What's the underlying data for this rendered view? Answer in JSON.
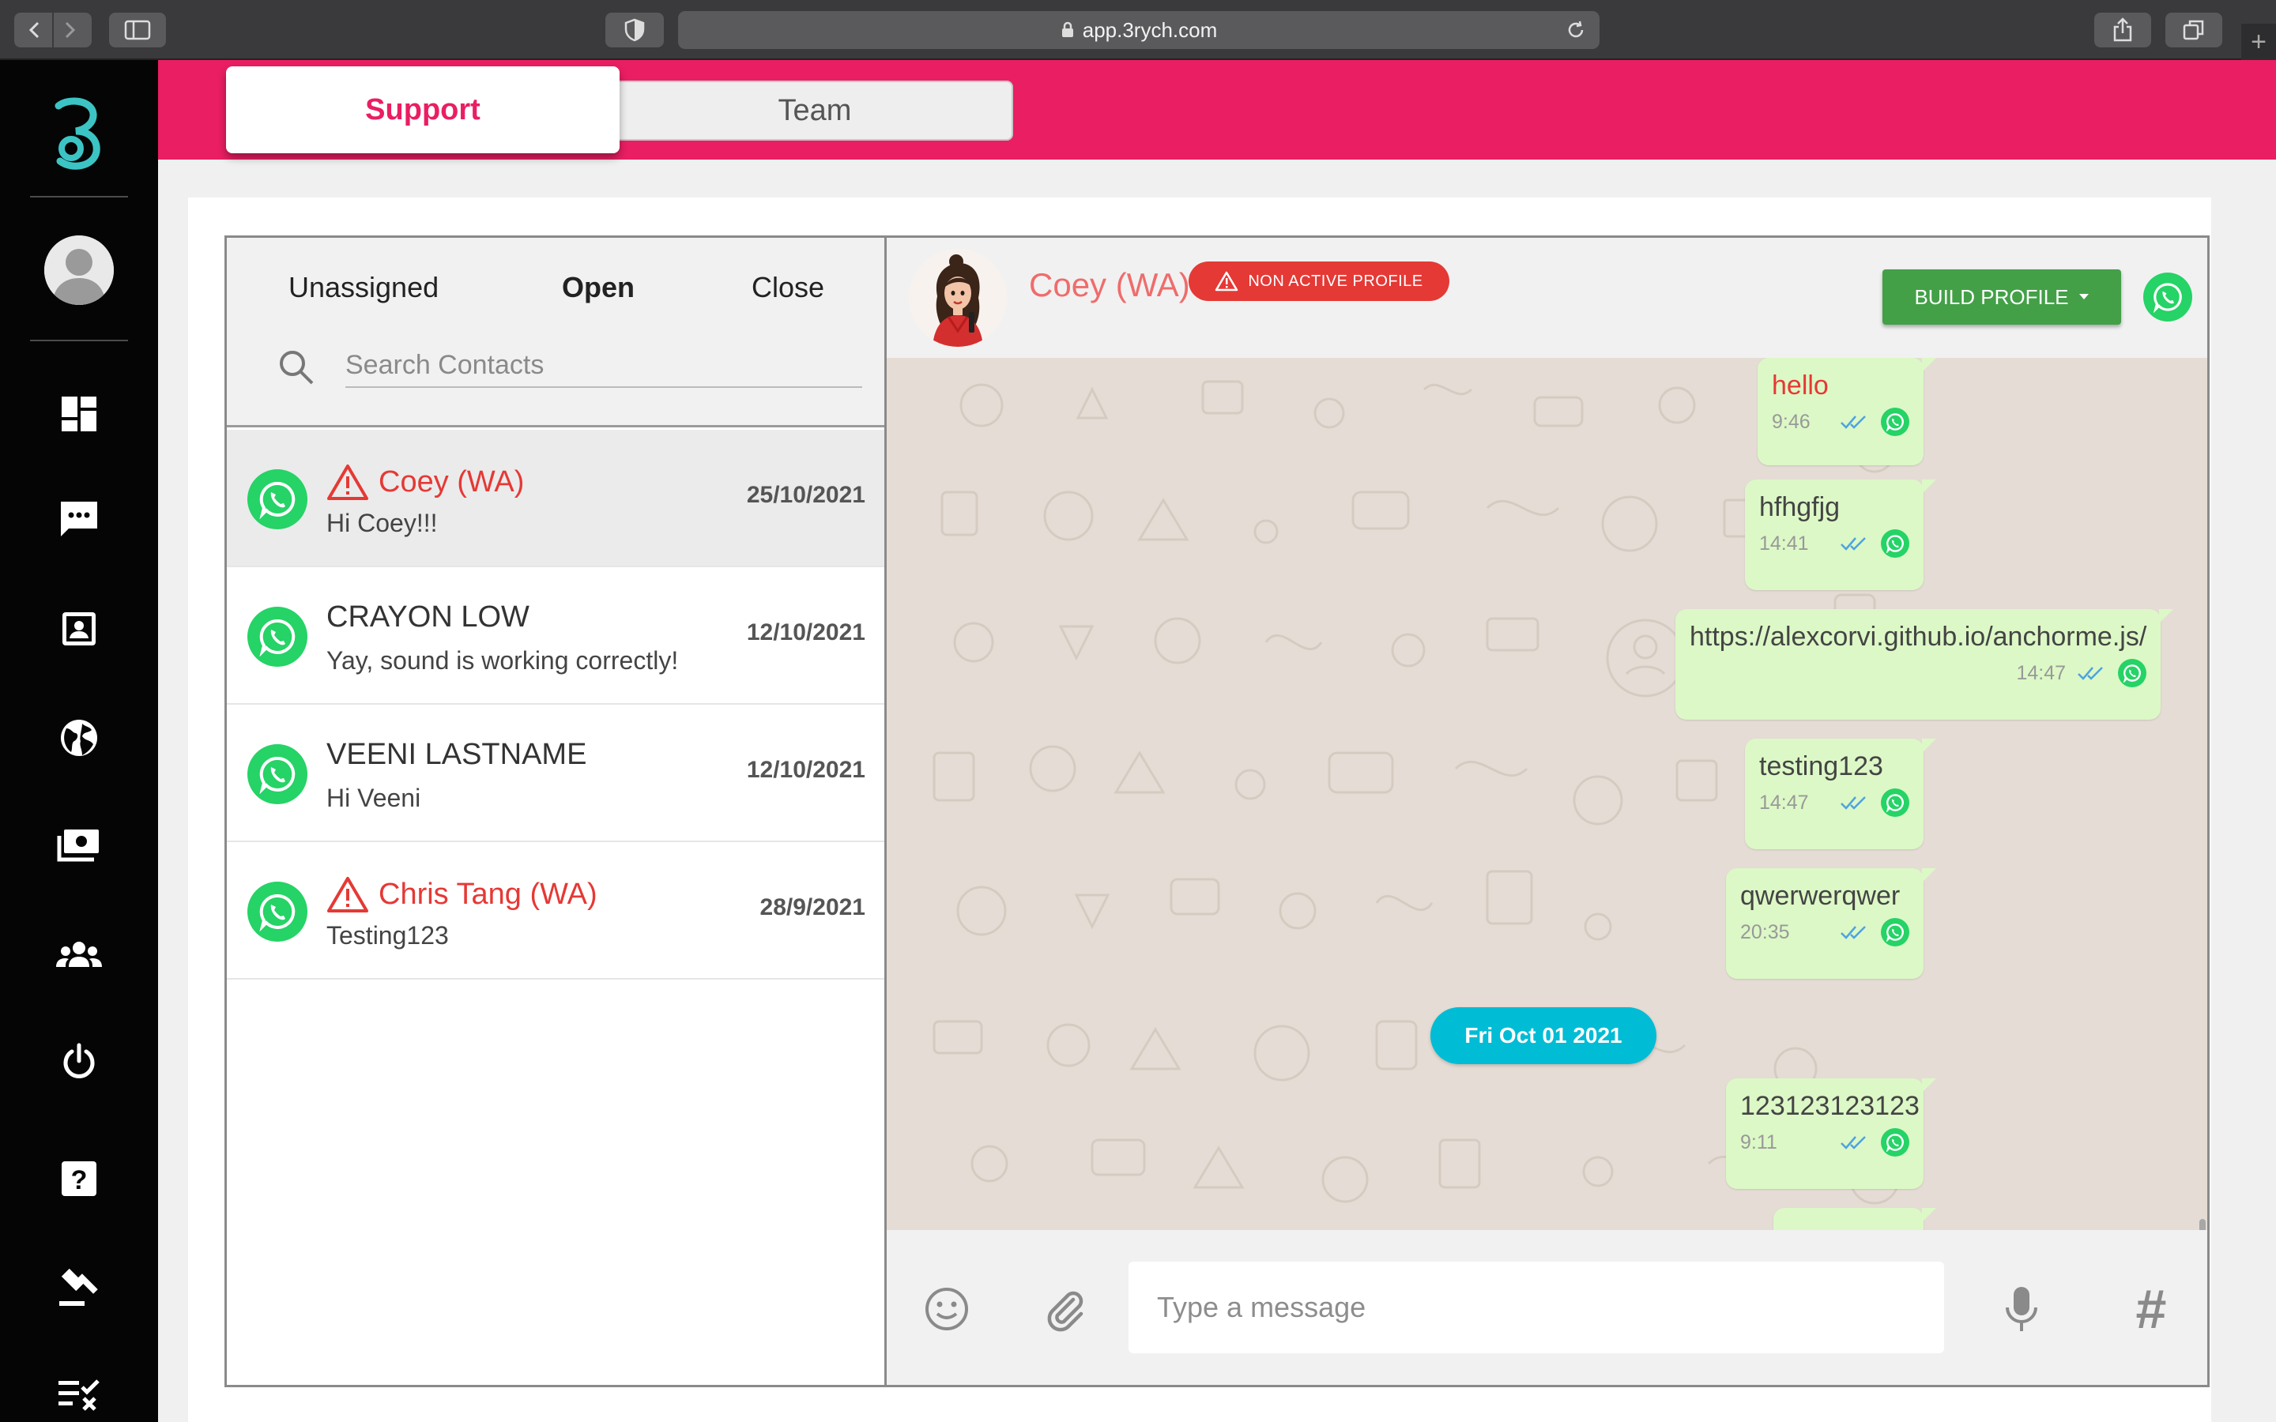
{
  "browser": {
    "url": "app.3rych.com",
    "new_tab_label": "+"
  },
  "nav": {
    "logo": "3rych-logo",
    "items": [
      {
        "name": "dashboard-icon"
      },
      {
        "name": "chat-icon"
      },
      {
        "name": "contacts-icon"
      },
      {
        "name": "globe-icon"
      },
      {
        "name": "billing-icon"
      },
      {
        "name": "team-icon"
      },
      {
        "name": "power-icon"
      },
      {
        "name": "help-icon"
      },
      {
        "name": "gavel-icon"
      },
      {
        "name": "checklist-icon"
      }
    ]
  },
  "top_tabs": {
    "support": "Support",
    "team": "Team"
  },
  "contacts": {
    "tabs": {
      "unassigned": "Unassigned",
      "open": "Open",
      "close": "Close"
    },
    "active_tab": "Open",
    "search_placeholder": "Search Contacts",
    "items": [
      {
        "name": "Coey (WA)",
        "preview": "Hi Coey!!!",
        "date": "25/10/2021",
        "alert": true
      },
      {
        "name": "CRAYON LOW",
        "preview": "Yay, sound is working correctly!",
        "date": "12/10/2021",
        "alert": false
      },
      {
        "name": "VEENI LASTNAME",
        "preview": "Hi Veeni",
        "date": "12/10/2021",
        "alert": false
      },
      {
        "name": "Chris Tang (WA)",
        "preview": "Testing123",
        "date": "28/9/2021",
        "alert": true
      }
    ]
  },
  "chat": {
    "contact_name": "Coey (WA)",
    "badge": "NON ACTIVE PROFILE",
    "build_button": "BUILD PROFILE",
    "messages": [
      {
        "text": "hello",
        "time": "9:46",
        "highlight": true
      },
      {
        "text": "hfhgfjg",
        "time": "14:41",
        "highlight": false
      },
      {
        "text": "https://alexcorvi.github.io/anchorme.js/",
        "time": "14:47",
        "highlight": false
      },
      {
        "text": "testing123",
        "time": "14:47",
        "highlight": false
      },
      {
        "text": "qwerwerqwer",
        "time": "20:35",
        "highlight": false
      },
      {
        "text": "123123123123",
        "time": "9:11",
        "highlight": false
      }
    ],
    "date_separator": "Fri Oct 01 2021",
    "input_placeholder": "Type a message",
    "hashtag_label": "#"
  },
  "colors": {
    "brand_pink": "#e91e63",
    "whatsapp_green": "#25d366",
    "bubble_green": "#dcf8c6",
    "alert_red": "#e53935",
    "date_pill": "#00bcd4",
    "build_button": "#43a047",
    "logo_teal": "#3cc4c4"
  }
}
